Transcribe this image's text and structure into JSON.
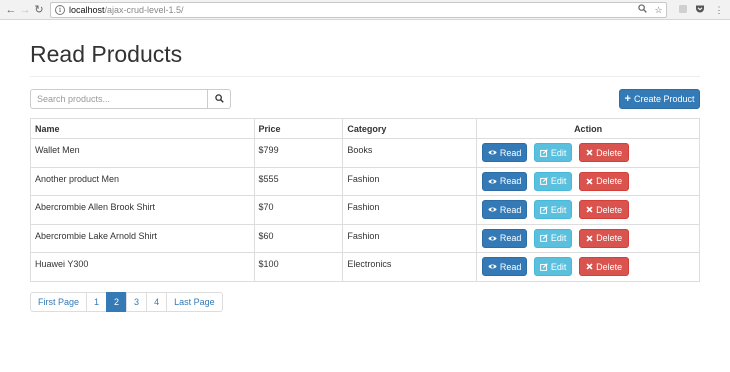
{
  "browser": {
    "url_host": "localhost",
    "url_path": "/ajax-crud-level-1.5/"
  },
  "page": {
    "title": "Read Products"
  },
  "search": {
    "placeholder": "Search products..."
  },
  "create_button": {
    "label": "Create Product"
  },
  "table": {
    "headers": {
      "name": "Name",
      "price": "Price",
      "category": "Category",
      "action": "Action"
    },
    "rows": [
      {
        "name": "Wallet Men",
        "price": "$799",
        "category": "Books"
      },
      {
        "name": "Another product Men",
        "price": "$555",
        "category": "Fashion"
      },
      {
        "name": "Abercrombie Allen Brook Shirt",
        "price": "$70",
        "category": "Fashion"
      },
      {
        "name": "Abercrombie Lake Arnold Shirt",
        "price": "$60",
        "category": "Fashion"
      },
      {
        "name": "Huawei Y300",
        "price": "$100",
        "category": "Electronics"
      }
    ],
    "row_actions": {
      "read": "Read",
      "edit": "Edit",
      "delete": "Delete"
    }
  },
  "pagination": {
    "items": [
      "First Page",
      "1",
      "2",
      "3",
      "4",
      "Last Page"
    ],
    "active": "2"
  },
  "colors": {
    "primary": "#337ab7",
    "info": "#5bc0de",
    "danger": "#d9534f"
  }
}
